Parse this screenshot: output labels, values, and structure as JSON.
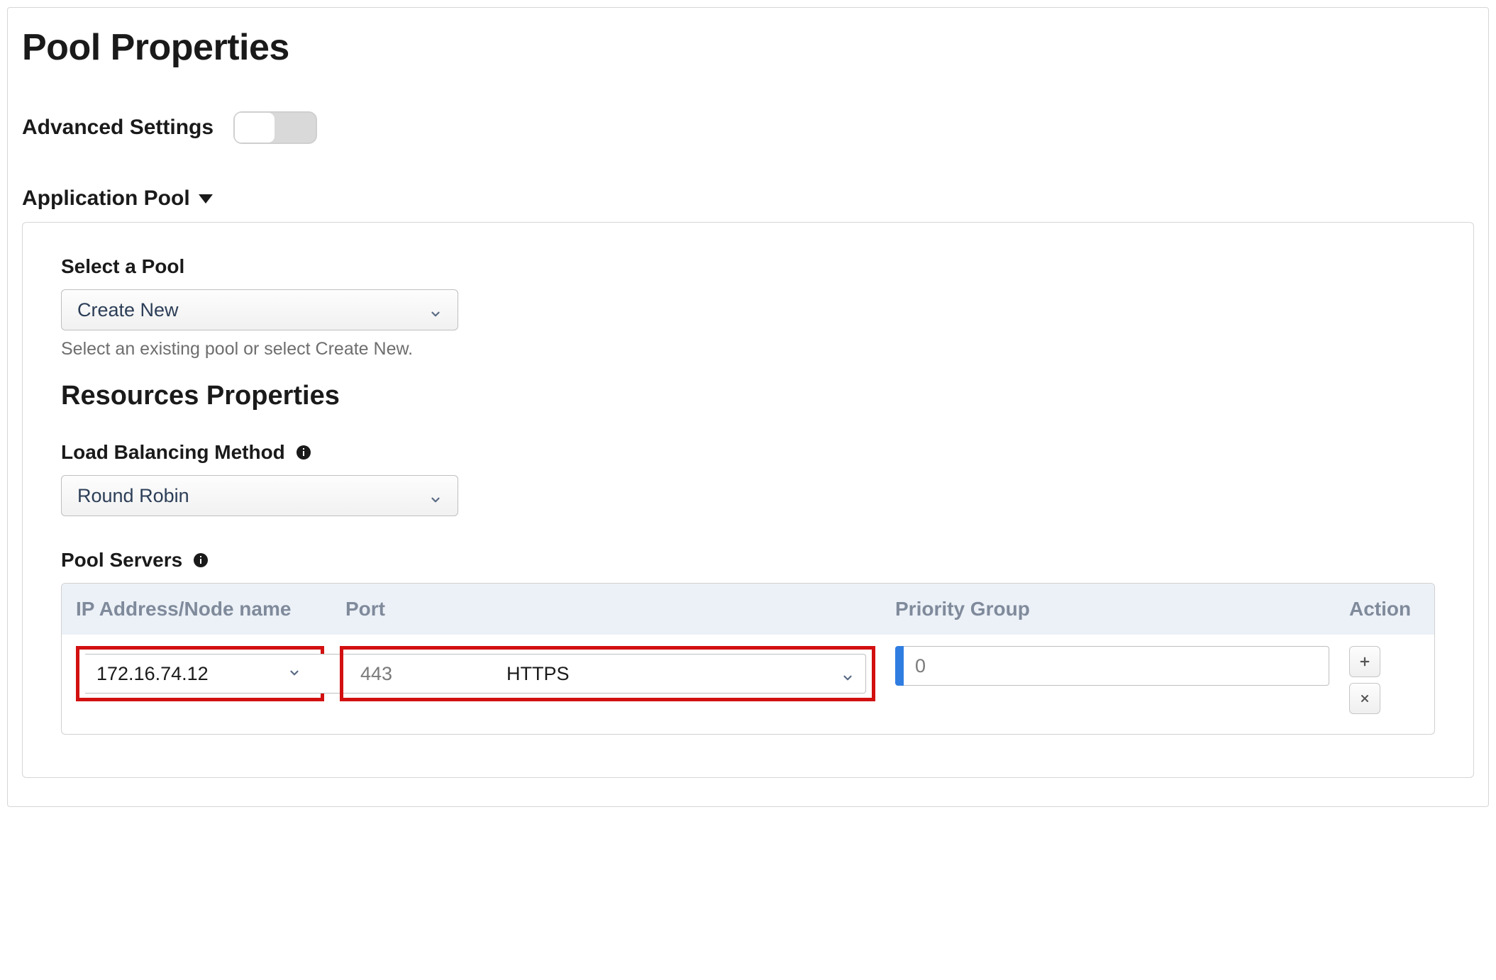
{
  "page": {
    "title": "Pool Properties",
    "advanced_label": "Advanced Settings",
    "section_title": "Application Pool"
  },
  "pool": {
    "select_pool_label": "Select a Pool",
    "select_pool_value": "Create New",
    "select_pool_help": "Select an existing pool or select Create New.",
    "resources_title": "Resources Properties",
    "lb_method_label": "Load Balancing Method",
    "lb_method_value": "Round Robin",
    "servers_label": "Pool Servers"
  },
  "servers_table": {
    "col_ip": "IP Address/Node name",
    "col_port": "Port",
    "col_priority": "Priority Group",
    "col_action": "Action",
    "rows": [
      {
        "ip": "172.16.74.12",
        "port": "443",
        "protocol": "HTTPS",
        "priority": "0"
      }
    ]
  }
}
